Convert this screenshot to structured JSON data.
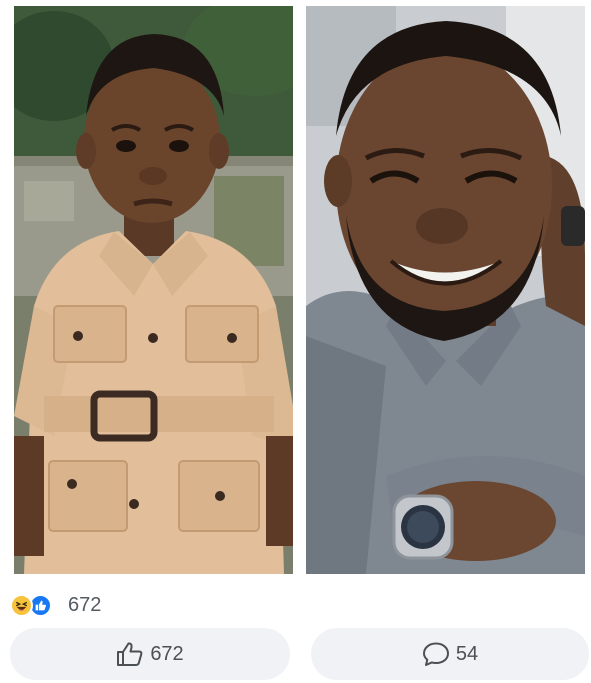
{
  "reactions": {
    "types": [
      "haha",
      "like"
    ],
    "count": "672"
  },
  "actions": {
    "like_count": "672",
    "comment_count": "54"
  },
  "photos": {
    "left_subject": "child-in-safari-suit",
    "right_subject": "smiling-bearded-man"
  },
  "colors": {
    "like_blue": "#1877f2",
    "haha_yellow": "#f7c33d",
    "button_bg": "#f0f2f5",
    "text_muted": "#555b63"
  },
  "icons": {
    "haha": "haha-reaction-icon",
    "like": "like-reaction-icon",
    "thumbs_up": "thumbs-up-icon",
    "comment": "comment-bubble-icon"
  }
}
